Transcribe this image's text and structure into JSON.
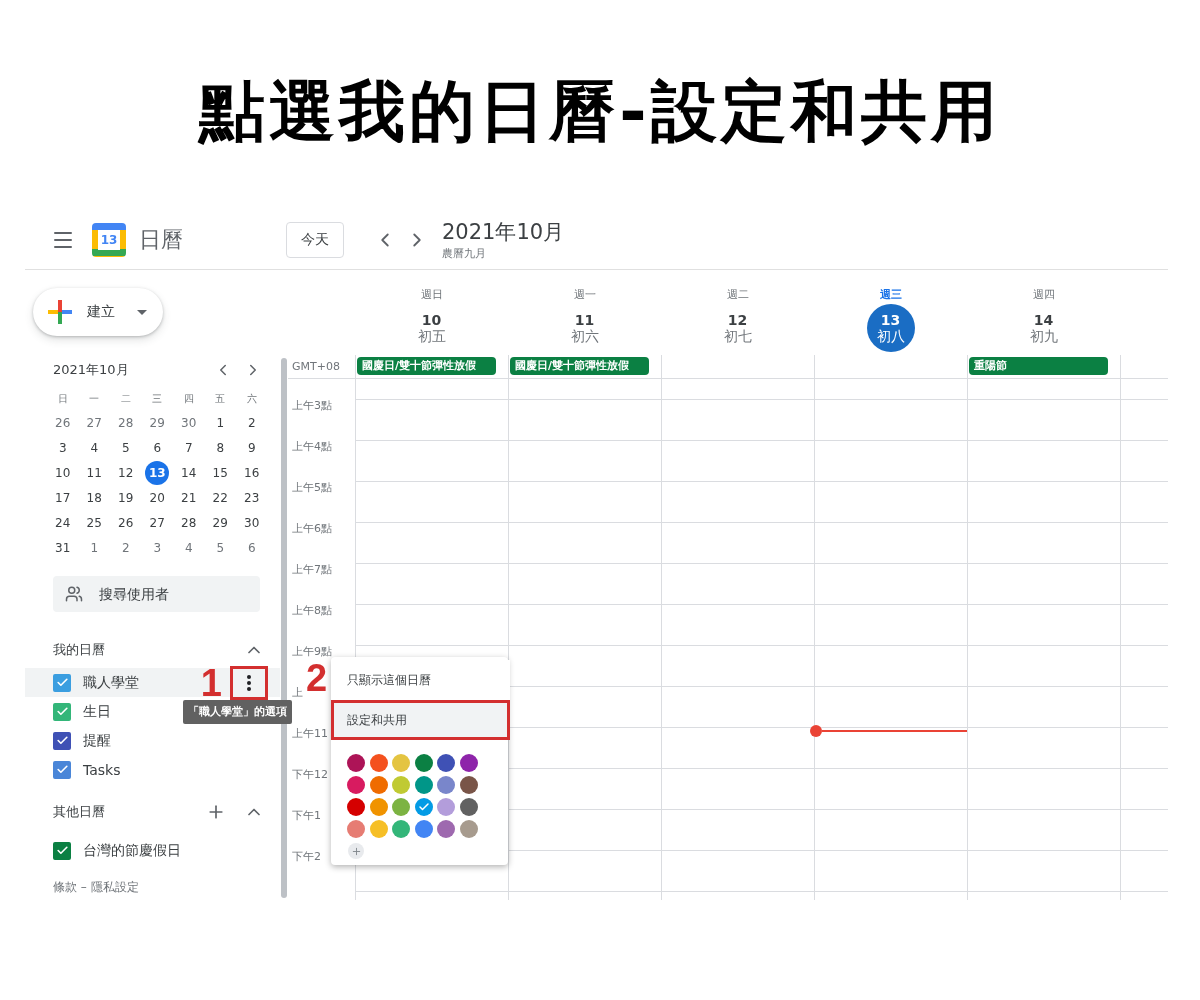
{
  "title": "點選我的日曆-設定和共用",
  "header": {
    "logo_text": "13",
    "app_name": "日曆",
    "today_button": "今天",
    "period": "2021年10月",
    "lunar_month": "農曆九月"
  },
  "sidebar": {
    "create_button": "建立",
    "mini_calendar": {
      "title": "2021年10月",
      "weekdays": [
        "日",
        "一",
        "二",
        "三",
        "四",
        "五",
        "六"
      ],
      "weeks": [
        [
          {
            "d": "26",
            "other_month": true,
            "selected": false
          },
          {
            "d": "27",
            "other_month": true,
            "selected": false
          },
          {
            "d": "28",
            "other_month": true,
            "selected": false
          },
          {
            "d": "29",
            "other_month": true,
            "selected": false
          },
          {
            "d": "30",
            "other_month": true,
            "selected": false
          },
          {
            "d": "1",
            "other_month": false,
            "selected": false
          },
          {
            "d": "2",
            "other_month": false,
            "selected": false
          }
        ],
        [
          {
            "d": "3",
            "other_month": false,
            "selected": false
          },
          {
            "d": "4",
            "other_month": false,
            "selected": false
          },
          {
            "d": "5",
            "other_month": false,
            "selected": false
          },
          {
            "d": "6",
            "other_month": false,
            "selected": false
          },
          {
            "d": "7",
            "other_month": false,
            "selected": false
          },
          {
            "d": "8",
            "other_month": false,
            "selected": false
          },
          {
            "d": "9",
            "other_month": false,
            "selected": false
          }
        ],
        [
          {
            "d": "10",
            "other_month": false,
            "selected": false
          },
          {
            "d": "11",
            "other_month": false,
            "selected": false
          },
          {
            "d": "12",
            "other_month": false,
            "selected": false
          },
          {
            "d": "13",
            "other_month": false,
            "selected": true
          },
          {
            "d": "14",
            "other_month": false,
            "selected": false
          },
          {
            "d": "15",
            "other_month": false,
            "selected": false
          },
          {
            "d": "16",
            "other_month": false,
            "selected": false
          }
        ],
        [
          {
            "d": "17",
            "other_month": false,
            "selected": false
          },
          {
            "d": "18",
            "other_month": false,
            "selected": false
          },
          {
            "d": "19",
            "other_month": false,
            "selected": false
          },
          {
            "d": "20",
            "other_month": false,
            "selected": false
          },
          {
            "d": "21",
            "other_month": false,
            "selected": false
          },
          {
            "d": "22",
            "other_month": false,
            "selected": false
          },
          {
            "d": "23",
            "other_month": false,
            "selected": false
          }
        ],
        [
          {
            "d": "24",
            "other_month": false,
            "selected": false
          },
          {
            "d": "25",
            "other_month": false,
            "selected": false
          },
          {
            "d": "26",
            "other_month": false,
            "selected": false
          },
          {
            "d": "27",
            "other_month": false,
            "selected": false
          },
          {
            "d": "28",
            "other_month": false,
            "selected": false
          },
          {
            "d": "29",
            "other_month": false,
            "selected": false
          },
          {
            "d": "30",
            "other_month": false,
            "selected": false
          }
        ],
        [
          {
            "d": "31",
            "other_month": false,
            "selected": false
          },
          {
            "d": "1",
            "other_month": true,
            "selected": false
          },
          {
            "d": "2",
            "other_month": true,
            "selected": false
          },
          {
            "d": "3",
            "other_month": true,
            "selected": false
          },
          {
            "d": "4",
            "other_month": true,
            "selected": false
          },
          {
            "d": "5",
            "other_month": true,
            "selected": false
          },
          {
            "d": "6",
            "other_month": true,
            "selected": false
          }
        ]
      ]
    },
    "search": {
      "placeholder": "搜尋使用者"
    },
    "my_calendars": {
      "heading": "我的日曆",
      "expanded": true,
      "items": [
        {
          "name": "職人學堂",
          "checked": true,
          "color": "#3b9ee0",
          "highlighted": true,
          "tooltip": "「職人學堂」的選項"
        },
        {
          "name": "生日",
          "checked": true,
          "color": "#33b679",
          "highlighted": false
        },
        {
          "name": "提醒",
          "checked": true,
          "color": "#3f51b5",
          "highlighted": false
        },
        {
          "name": "Tasks",
          "checked": true,
          "color": "#4a86d8",
          "highlighted": false
        }
      ]
    },
    "other_calendars": {
      "heading": "其他日曆",
      "expanded": true,
      "items": [
        {
          "name": "台灣的節慶假日",
          "checked": true,
          "color": "#0b8043",
          "highlighted": false
        }
      ]
    },
    "footer": "條款 – 隱私設定"
  },
  "week": {
    "timezone": "GMT+08",
    "days": [
      {
        "weekday": "週日",
        "date": "10",
        "lunar": "初五",
        "selected": false,
        "all_day": [
          "國慶日/雙十節彈性放假"
        ]
      },
      {
        "weekday": "週一",
        "date": "11",
        "lunar": "初六",
        "selected": false,
        "all_day": [
          "國慶日/雙十節彈性放假"
        ]
      },
      {
        "weekday": "週二",
        "date": "12",
        "lunar": "初七",
        "selected": false
      },
      {
        "weekday": "週三",
        "date": "13",
        "lunar": "初八",
        "selected": true,
        "now_line": true
      },
      {
        "weekday": "週四",
        "date": "14",
        "lunar": "初九",
        "selected": false,
        "all_day": [
          "重陽節"
        ]
      }
    ],
    "hours": [
      "上午3點",
      "上午4點",
      "上午5點",
      "上午6點",
      "上午7點",
      "上午8點",
      "上午9點",
      "上",
      "上午11",
      "下午12",
      "下午1",
      "下午2"
    ]
  },
  "steps": [
    {
      "number": "1"
    },
    {
      "number": "2"
    }
  ],
  "menu": {
    "items": [
      {
        "label": "只顯示這個日曆",
        "selected": false
      },
      {
        "label": "設定和共用",
        "selected": true
      }
    ],
    "swatches": [
      {
        "color": "#ad1457",
        "selected": false
      },
      {
        "color": "#f4511e",
        "selected": false
      },
      {
        "color": "#e4c441",
        "selected": false
      },
      {
        "color": "#0b8043",
        "selected": false
      },
      {
        "color": "#3f51b5",
        "selected": false
      },
      {
        "color": "#8e24aa",
        "selected": false
      },
      {
        "color": "#d81b60",
        "selected": false
      },
      {
        "color": "#ef6c00",
        "selected": false
      },
      {
        "color": "#c0ca33",
        "selected": false
      },
      {
        "color": "#009688",
        "selected": false
      },
      {
        "color": "#7986cb",
        "selected": false
      },
      {
        "color": "#795548",
        "selected": false
      },
      {
        "color": "#d50000",
        "selected": false
      },
      {
        "color": "#f09300",
        "selected": false
      },
      {
        "color": "#7cb342",
        "selected": false
      },
      {
        "color": "#039be5",
        "selected": true
      },
      {
        "color": "#b39ddb",
        "selected": false
      },
      {
        "color": "#616161",
        "selected": false
      },
      {
        "color": "#e67c73",
        "selected": false
      },
      {
        "color": "#f6bf26",
        "selected": false
      },
      {
        "color": "#33b679",
        "selected": false
      },
      {
        "color": "#4285f4",
        "selected": false
      },
      {
        "color": "#9e69af",
        "selected": false
      },
      {
        "color": "#a79b8e",
        "selected": false
      }
    ]
  }
}
